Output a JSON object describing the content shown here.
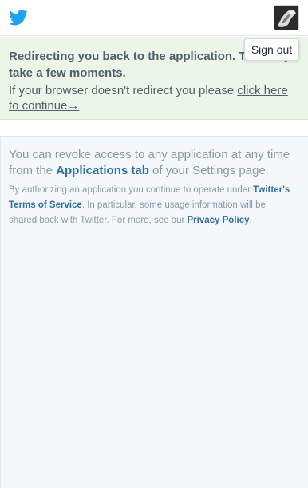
{
  "header": {
    "logo_icon": "twitter-bird-icon",
    "avatar_icon": "user-avatar",
    "brand_color": "#1da1f2"
  },
  "account_menu": {
    "signout_label": "Sign out"
  },
  "notice": {
    "title": "Redirecting you back to the application. This may take a few moments.",
    "body_prefix": "If your browser doesn't redirect you please ",
    "redirect_link": "click here to continue→"
  },
  "info": {
    "revoke_prefix": "You can revoke access to any application at any time from the ",
    "applications_tab_link": "Applications tab",
    "revoke_suffix": " of your Settings page.",
    "legal_prefix": "By authorizing an application you continue to operate under ",
    "tos_link": "Twitter's Terms of Service",
    "legal_middle": ". In particular, some usage information will be shared back with Twitter. For more, see our ",
    "privacy_link": "Privacy Policy",
    "legal_suffix": "."
  }
}
